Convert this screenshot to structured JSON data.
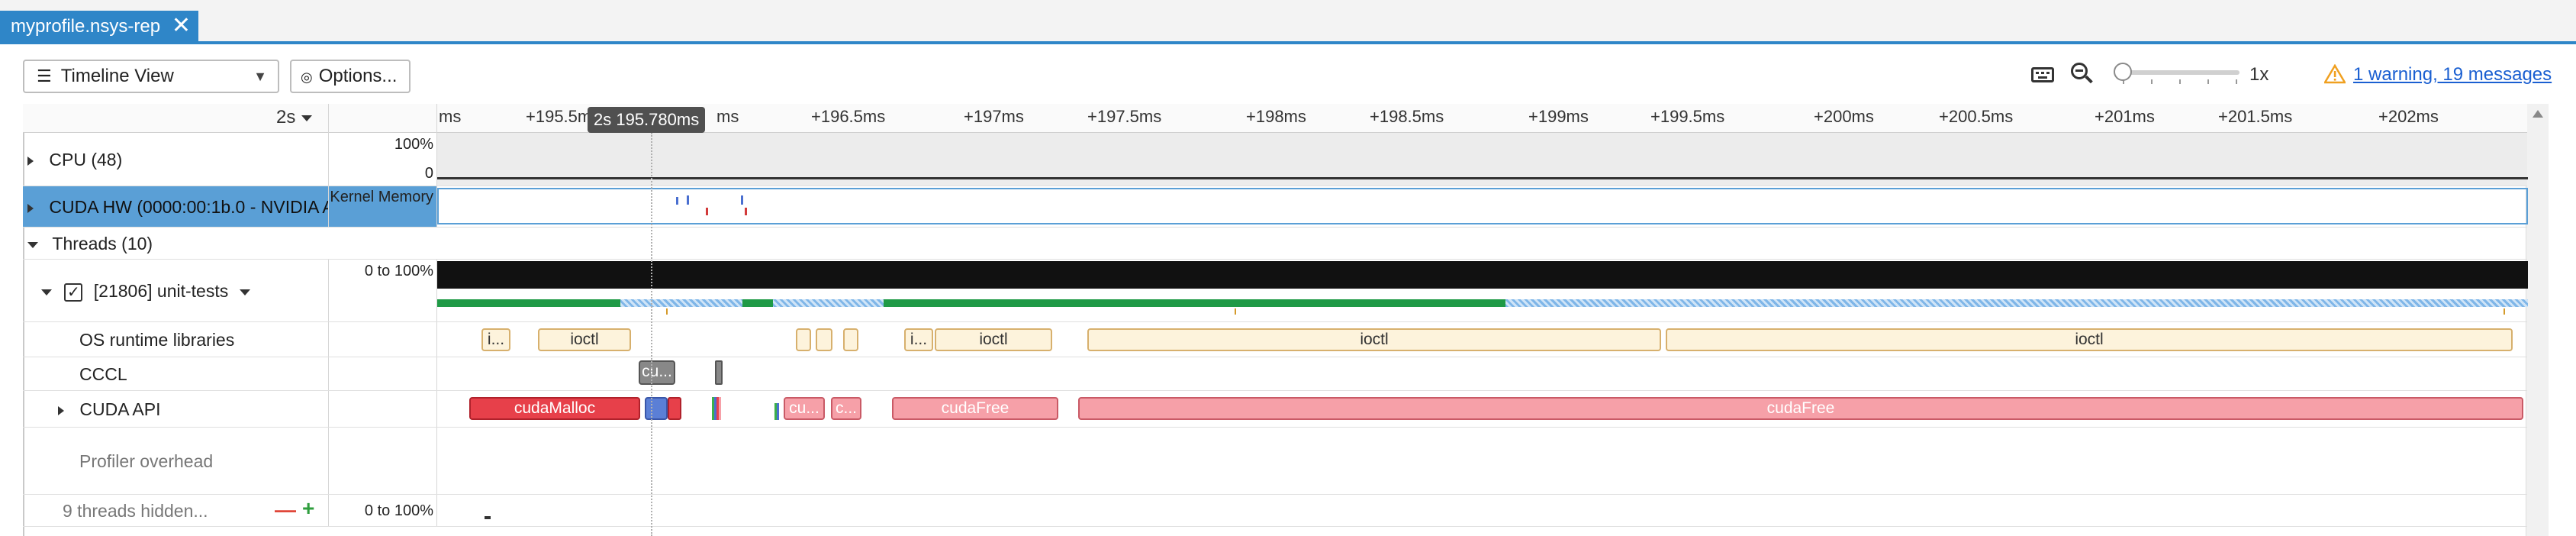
{
  "tab": {
    "title": "myprofile.nsys-rep",
    "close_glyph": "✕"
  },
  "toolbar": {
    "view_label": "Timeline View",
    "options_label": "Options...",
    "zoom_level": "1x",
    "warnings_link": "1 warning, 19 messages",
    "colors": {
      "accent": "#2f86c8",
      "link": "#1a5fd1",
      "warning": "#f0a020"
    }
  },
  "ruler": {
    "ratio_label": "2s",
    "cursor_time": "2s 195.780ms",
    "ticks": [
      "ms",
      "+195.5ms",
      "ms",
      "+196.5ms",
      "+197ms",
      "+197.5ms",
      "+198ms",
      "+198.5ms",
      "+199ms",
      "+199.5ms",
      "+200ms",
      "+200.5ms",
      "+201ms",
      "+201.5ms",
      "+202ms"
    ]
  },
  "rows": {
    "cpu": {
      "label": "CPU (48)",
      "scale_top": "100%",
      "scale_bottom": "0"
    },
    "cuda_hw": {
      "label": "CUDA HW (0000:00:1b.0 - NVIDIA A",
      "scale": "Kernel Memory"
    },
    "threads": {
      "label": "Threads (10)"
    },
    "thread": {
      "label": "[21806] unit-tests",
      "checked": true,
      "scale": "0 to 100%"
    },
    "os_runtime": {
      "label": "OS runtime libraries",
      "slabs": [
        "i...",
        "ioctl",
        "i...",
        "ioctl",
        "ioctl",
        "ioctl"
      ]
    },
    "cccl": {
      "label": "CCCL",
      "slabs": [
        "cu..."
      ]
    },
    "cuda_api": {
      "label": "CUDA API",
      "slabs": [
        "cudaMalloc",
        "cu...",
        "c...",
        "cudaFree",
        "cudaFree"
      ]
    },
    "profiler": {
      "label": "Profiler overhead"
    },
    "hidden": {
      "label": "9 threads hidden...",
      "minus": "—",
      "plus": "+",
      "scale": "0 to 100%"
    }
  }
}
